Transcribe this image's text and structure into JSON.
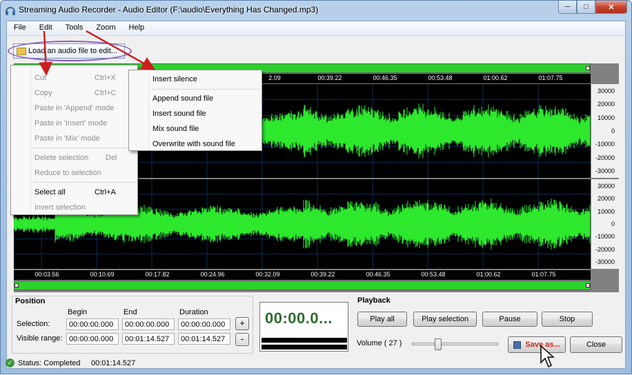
{
  "window": {
    "title": "Streaming Audio Recorder - Audio Editor (F:\\audio\\Everything Has Changed.mp3)",
    "minimize_icon": "minimize-icon",
    "maximize_icon": "maximize-icon",
    "close_icon": "close-icon"
  },
  "menubar": {
    "items": [
      "File",
      "Edit",
      "Tools",
      "Zoom",
      "Help"
    ]
  },
  "toolbar": {
    "load_label": "Load an audio file to edit..."
  },
  "ruler": {
    "top_visible": [
      "2.09",
      "00:39.22",
      "00:46.35",
      "00:53.48",
      "01:00.62",
      "01:07.75"
    ],
    "bottom": [
      "00:03.56",
      "00:10.69",
      "00:17.82",
      "00:24.96",
      "00:32.09",
      "00:39.22",
      "00:46.35",
      "00:53.48",
      "01:00.62",
      "01:07.75"
    ]
  },
  "scale": {
    "ticks": [
      "30000",
      "20000",
      "10000",
      "0",
      "-10000",
      "-20000",
      "-30000"
    ]
  },
  "position": {
    "title": "Position",
    "begin_label": "Begin",
    "end_label": "End",
    "duration_label": "Duration",
    "selection_label": "Selection:",
    "visible_label": "Visible range:",
    "selection_begin": "00:00:00.000",
    "selection_end": "00:00:00.000",
    "selection_duration": "00:00:00.000",
    "visible_begin": "00:00:00.000",
    "visible_end": "00:01:14.527",
    "visible_duration": "00:01:14.527",
    "plus": "+",
    "minus": "-"
  },
  "timer": {
    "value": "00:00.0..."
  },
  "playback": {
    "title": "Playback",
    "play_all": "Play all",
    "play_selection": "Play selection",
    "pause": "Pause",
    "stop": "Stop",
    "volume_label": "Volume ( 27 )",
    "volume": 27,
    "save_as": "Save as...",
    "close": "Close"
  },
  "status": {
    "text": "Status: Completed",
    "time": "00:01:14.527"
  },
  "edit_menu": {
    "items": [
      {
        "label": "Cut",
        "shortcut": "Ctrl+X"
      },
      {
        "label": "Copy",
        "shortcut": "Ctrl+C"
      },
      {
        "label": "Paste in 'Append' mode",
        "shortcut": ""
      },
      {
        "label": "Paste in 'Insert' mode",
        "shortcut": ""
      },
      {
        "label": "Paste in 'Mix' mode",
        "shortcut": ""
      },
      {
        "label": "Delete selection",
        "shortcut": "Del"
      },
      {
        "label": "Reduce to selection",
        "shortcut": ""
      },
      {
        "label": "Select all",
        "shortcut": "Ctrl+A"
      },
      {
        "label": "Invert selection",
        "shortcut": ""
      }
    ]
  },
  "tools_menu": {
    "items": [
      "Insert silence",
      "Append sound file",
      "Insert sound file",
      "Mix sound file",
      "Overwrite with sound file"
    ]
  },
  "colors": {
    "waveform": "#2ee82e",
    "annotation_arrow": "#cc1f1f",
    "annotation_ellipse": "#8b5fb9"
  }
}
